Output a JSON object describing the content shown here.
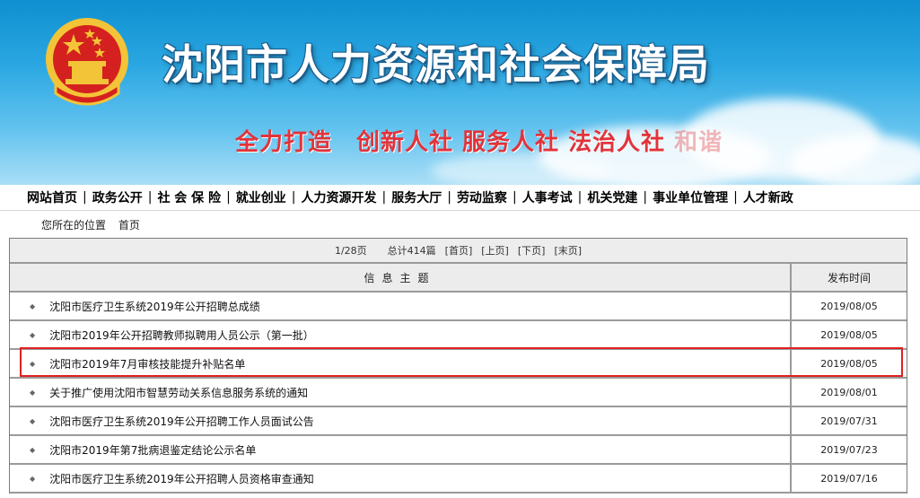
{
  "header": {
    "site_title": "沈阳市人力资源和社会保障局",
    "slogan_main": "全力打造　创新人社  服务人社  法治人社",
    "slogan_faded": "  和谐"
  },
  "nav": {
    "items": [
      {
        "label": "网站首页"
      },
      {
        "label": "政务公开"
      },
      {
        "label": "社 会 保 险"
      },
      {
        "label": "就业创业"
      },
      {
        "label": "人力资源开发"
      },
      {
        "label": "服务大厅"
      },
      {
        "label": "劳动监察"
      },
      {
        "label": "人事考试"
      },
      {
        "label": "机关党建"
      },
      {
        "label": "事业单位管理"
      },
      {
        "label": "人才新政"
      }
    ]
  },
  "breadcrumb": {
    "label": "您所在的位置",
    "current": "首页"
  },
  "pager": {
    "page": "1/28页",
    "total": "总计414篇",
    "first": "[首页]",
    "prev": "[上页]",
    "next": "[下页]",
    "last": "[末页]"
  },
  "table": {
    "col_title": "信息主题",
    "col_date": "发布时间",
    "bullet": "◆",
    "rows": [
      {
        "title": "沈阳市医疗卫生系统2019年公开招聘总成绩",
        "date": "2019/08/05"
      },
      {
        "title": "沈阳市2019年公开招聘教师拟聘用人员公示（第一批）",
        "date": "2019/08/05"
      },
      {
        "title": "沈阳市2019年7月审核技能提升补贴名单",
        "date": "2019/08/05"
      },
      {
        "title": "关于推广使用沈阳市智慧劳动关系信息服务系统的通知",
        "date": "2019/08/01"
      },
      {
        "title": "沈阳市医疗卫生系统2019年公开招聘工作人员面试公告",
        "date": "2019/07/31"
      },
      {
        "title": "沈阳市2019年第7批病退鉴定结论公示名单",
        "date": "2019/07/23"
      },
      {
        "title": "沈阳市医疗卫生系统2019年公开招聘人员资格审查通知",
        "date": "2019/07/16"
      }
    ]
  },
  "colors": {
    "highlight_border": "#e02020",
    "slogan": "#e2333a",
    "emblem_red": "#d4211f",
    "emblem_gold": "#f3c437"
  }
}
